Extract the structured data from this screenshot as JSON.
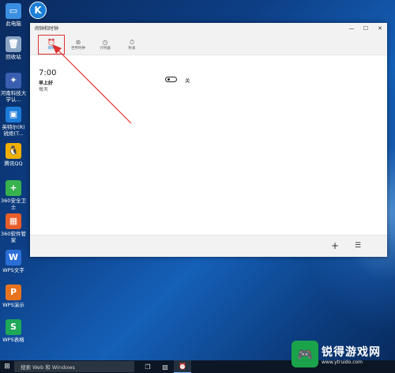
{
  "desktop": {
    "icons": [
      {
        "label": "此电脑",
        "icon": "computer-icon",
        "glyph": "▭",
        "color": "#3b8fe0"
      },
      {
        "label": "回收站",
        "icon": "recycle-bin-icon",
        "glyph": "🗑",
        "color": "#8aa6c4"
      },
      {
        "label": "河南科技大学认...",
        "icon": "app-icon",
        "glyph": "✦",
        "color": "#3a5fb0"
      },
      {
        "label": "英特尔(R)锐炬(T...",
        "icon": "intel-graphics-icon",
        "glyph": "▣",
        "color": "#1d7bd8"
      },
      {
        "label": "腾讯QQ",
        "icon": "qq-penguin-icon",
        "glyph": "🐧",
        "color": "#f0b000"
      },
      {
        "label": "360安全卫士",
        "icon": "360-security-icon",
        "glyph": "+",
        "color": "#37b24d"
      },
      {
        "label": "360软件管家",
        "icon": "360-software-icon",
        "glyph": "▦",
        "color": "#e85d2a"
      },
      {
        "label": "WPS文字",
        "icon": "wps-writer-icon",
        "glyph": "W",
        "color": "#2b6fd6"
      },
      {
        "label": "WPS演示",
        "icon": "wps-presentation-icon",
        "glyph": "P",
        "color": "#e8731f"
      },
      {
        "label": "WPS表格",
        "icon": "wps-spreadsheet-icon",
        "glyph": "S",
        "color": "#1fa85a"
      }
    ],
    "top_app_icon": "K"
  },
  "window": {
    "title": "闹钟和时钟",
    "controls": {
      "minimize": "—",
      "maximize": "☐",
      "close": "✕"
    },
    "tabs": [
      {
        "label": "闹钟",
        "icon": "alarm-clock-icon",
        "glyph": "⏰",
        "active": true
      },
      {
        "label": "世界时钟",
        "icon": "world-clock-icon",
        "glyph": "⊛",
        "active": false
      },
      {
        "label": "计时器",
        "icon": "timer-icon",
        "glyph": "◷",
        "active": false
      },
      {
        "label": "秒表",
        "icon": "stopwatch-icon",
        "glyph": "⏱",
        "active": false
      }
    ],
    "alarm": {
      "time": "7:00",
      "name": "早上好",
      "repeat": "每天",
      "toggle_label": "关",
      "enabled": false
    },
    "bottom": {
      "add": "+",
      "select": "☰"
    }
  },
  "taskbar": {
    "start_glyph": "⊞",
    "search_placeholder": "搜索 Web 和 Windows",
    "items": [
      {
        "glyph": "❐",
        "icon": "task-view-icon",
        "active": false
      },
      {
        "glyph": "▧",
        "icon": "app-window-icon",
        "active": false
      },
      {
        "glyph": "⏰",
        "icon": "alarm-app-icon",
        "active": true
      }
    ]
  },
  "watermark": {
    "logo_glyph": "🎮",
    "name": "锐得游戏网",
    "url": "www.ytruido.com"
  },
  "colors": {
    "accent": "#0b6fd0",
    "highlight_box": "#e03030",
    "arrow": "#e03030"
  }
}
